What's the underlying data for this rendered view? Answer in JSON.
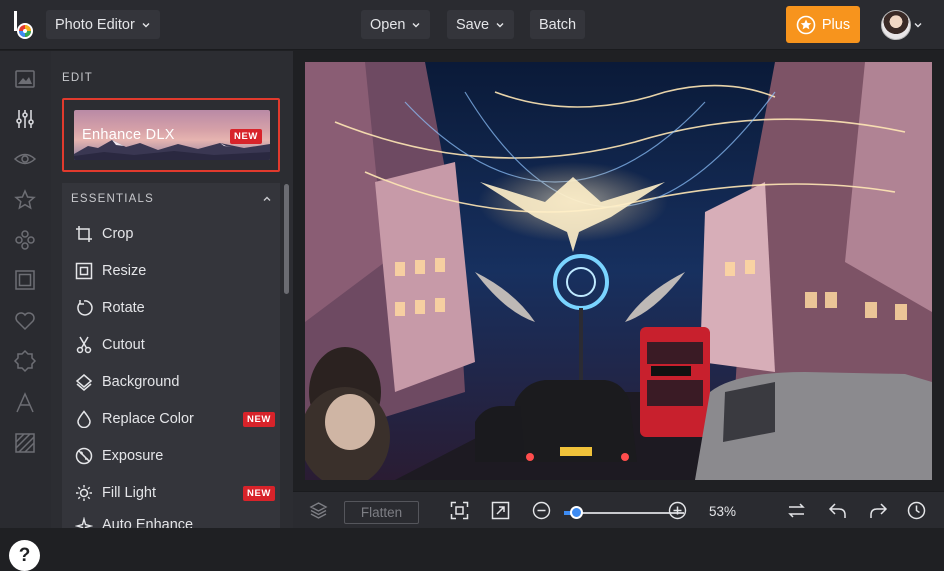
{
  "topbar": {
    "app_menu_label": "Photo Editor",
    "open_label": "Open",
    "save_label": "Save",
    "batch_label": "Batch",
    "plus_label": "Plus",
    "accent": "#f7941d"
  },
  "rail": {
    "icons": [
      "image-icon",
      "sliders-icon",
      "eye-icon",
      "star-icon",
      "stickers-icon",
      "frame-icon",
      "heart-icon",
      "badge-icon",
      "text-icon",
      "texture-icon"
    ],
    "help_label": "?"
  },
  "panel": {
    "edit_title": "EDIT",
    "enhance": {
      "label": "Enhance DLX",
      "badge": "NEW"
    },
    "essentials_title": "ESSENTIALS",
    "tools": [
      {
        "label": "Crop",
        "icon": "crop-icon",
        "badge": ""
      },
      {
        "label": "Resize",
        "icon": "resize-icon",
        "badge": ""
      },
      {
        "label": "Rotate",
        "icon": "rotate-icon",
        "badge": ""
      },
      {
        "label": "Cutout",
        "icon": "scissors-icon",
        "badge": ""
      },
      {
        "label": "Background",
        "icon": "background-icon",
        "badge": ""
      },
      {
        "label": "Replace Color",
        "icon": "drop-icon",
        "badge": "NEW"
      },
      {
        "label": "Exposure",
        "icon": "exposure-icon",
        "badge": ""
      },
      {
        "label": "Fill Light",
        "icon": "sun-icon",
        "badge": "NEW"
      },
      {
        "label": "Auto Enhance",
        "icon": "auto-enhance-icon",
        "badge": ""
      }
    ],
    "new_badge_color": "#d8232a"
  },
  "bottombar": {
    "flatten_label": "Flatten",
    "zoom_label": "53%",
    "zoom_level": 0.53
  }
}
